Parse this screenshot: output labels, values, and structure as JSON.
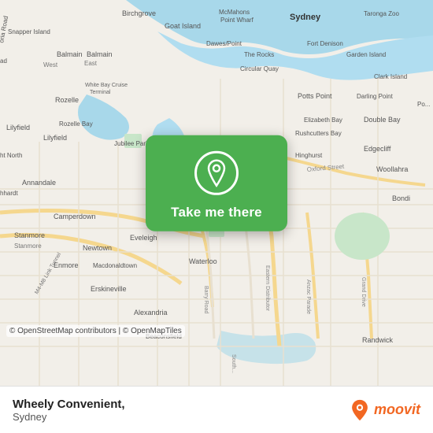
{
  "map": {
    "attribution": "© OpenStreetMap contributors | © OpenMapTiles",
    "center_label": "Goat Island",
    "background_color": "#f2efe9"
  },
  "action_card": {
    "label": "Take me there",
    "pin_icon": "location-pin"
  },
  "bottom_bar": {
    "location_name": "Wheely Convenient,",
    "location_city": "Sydney",
    "brand_name": "moovit"
  }
}
